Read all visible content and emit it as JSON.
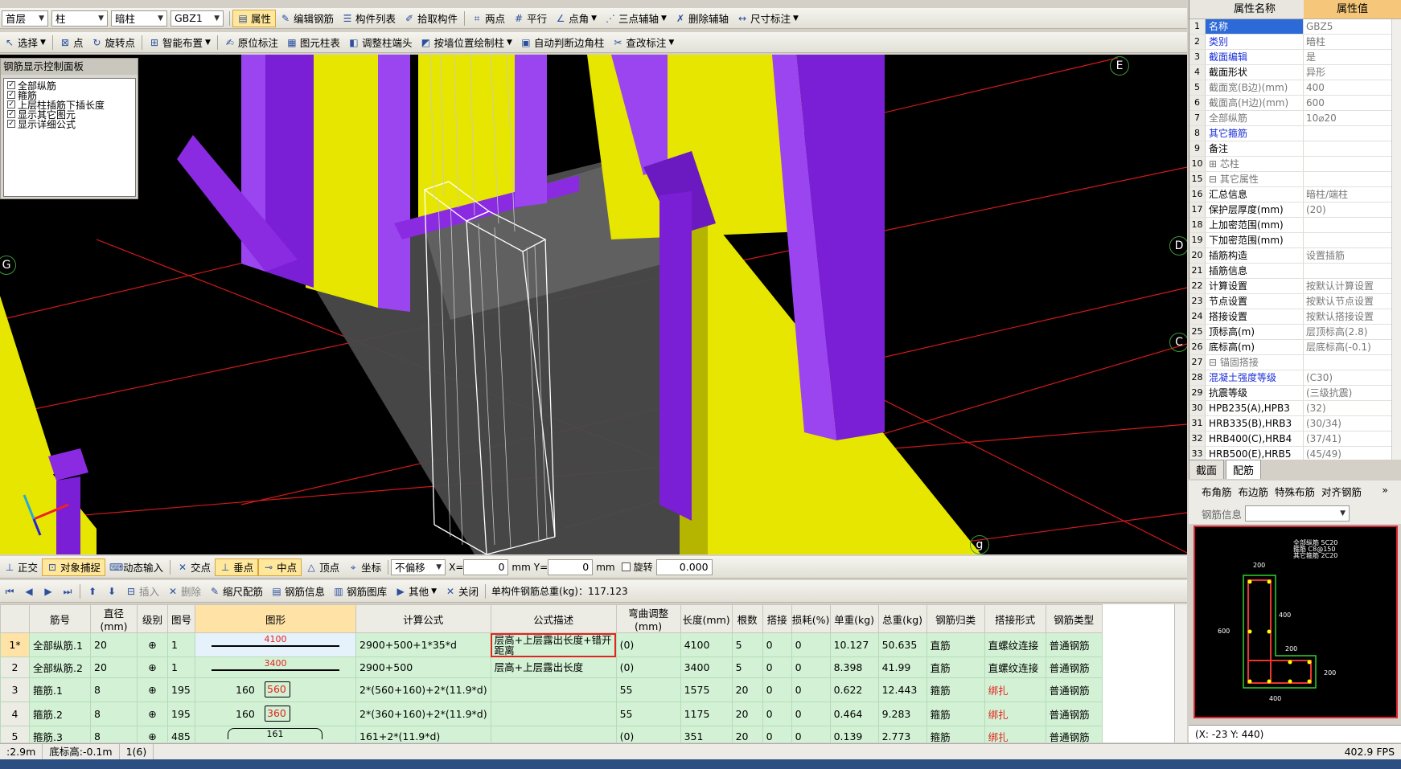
{
  "toolbar1": {
    "floor": "首层",
    "type": "柱",
    "subtype": "暗柱",
    "element": "GBZ1",
    "buttons": [
      "属性",
      "编辑钢筋",
      "构件列表",
      "拾取构件",
      "两点",
      "平行",
      "点角",
      "三点辅轴",
      "删除辅轴",
      "尺寸标注"
    ]
  },
  "toolbar2": {
    "buttons": [
      "选择",
      "点",
      "旋转点",
      "智能布置",
      "原位标注",
      "图元柱表",
      "调整柱端头",
      "按墙位置绘制柱",
      "自动判断边角柱",
      "查改标注"
    ]
  },
  "rebar_panel": {
    "title": "钢筋显示控制面板",
    "options": [
      "全部纵筋",
      "箍筋",
      "上层柱插筋下插长度",
      "显示其它图元",
      "显示详细公式"
    ]
  },
  "axis_labels": [
    "E",
    "D",
    "C",
    "G",
    "g"
  ],
  "properties": {
    "col_name": "属性名称",
    "col_value": "属性值",
    "rows": [
      {
        "n": "1",
        "name": "名称",
        "value": "GBZ5"
      },
      {
        "n": "2",
        "name": "类别",
        "value": "暗柱"
      },
      {
        "n": "3",
        "name": "截面编辑",
        "value": "是"
      },
      {
        "n": "4",
        "name": "截面形状",
        "value": "异形"
      },
      {
        "n": "5",
        "name": "截面宽(B边)(mm)",
        "value": "400"
      },
      {
        "n": "6",
        "name": "截面高(H边)(mm)",
        "value": "600"
      },
      {
        "n": "7",
        "name": "全部纵筋",
        "value": "10⌀20"
      },
      {
        "n": "8",
        "name": "其它箍筋",
        "value": ""
      },
      {
        "n": "9",
        "name": "备注",
        "value": ""
      },
      {
        "n": "10",
        "name": "⊞ 芯柱",
        "value": ""
      },
      {
        "n": "15",
        "name": "⊟ 其它属性",
        "value": ""
      },
      {
        "n": "16",
        "name": "  汇总信息",
        "value": "暗柱/端柱"
      },
      {
        "n": "17",
        "name": "  保护层厚度(mm)",
        "value": "(20)"
      },
      {
        "n": "18",
        "name": "  上加密范围(mm)",
        "value": ""
      },
      {
        "n": "19",
        "name": "  下加密范围(mm)",
        "value": ""
      },
      {
        "n": "20",
        "name": "  插筋构造",
        "value": "设置插筋"
      },
      {
        "n": "21",
        "name": "  插筋信息",
        "value": ""
      },
      {
        "n": "22",
        "name": "  计算设置",
        "value": "按默认计算设置"
      },
      {
        "n": "23",
        "name": "  节点设置",
        "value": "按默认节点设置"
      },
      {
        "n": "24",
        "name": "  搭接设置",
        "value": "按默认搭接设置"
      },
      {
        "n": "25",
        "name": "  顶标高(m)",
        "value": "层顶标高(2.8)"
      },
      {
        "n": "26",
        "name": "  底标高(m)",
        "value": "层底标高(-0.1)"
      },
      {
        "n": "27",
        "name": "⊟ 锚固搭接",
        "value": ""
      },
      {
        "n": "28",
        "name": "  混凝土强度等级",
        "value": "(C30)"
      },
      {
        "n": "29",
        "name": "  抗震等级",
        "value": "(三级抗震)"
      },
      {
        "n": "30",
        "name": "  HPB235(A),HPB3",
        "value": "(32)"
      },
      {
        "n": "31",
        "name": "  HRB335(B),HRB3",
        "value": "(30/34)"
      },
      {
        "n": "32",
        "name": "  HRB400(C),HRB4",
        "value": "(37/41)"
      },
      {
        "n": "33",
        "name": "  HRB500(E),HRB5",
        "value": "(45/49)"
      }
    ]
  },
  "right_tabs": [
    "截面",
    "配筋"
  ],
  "rebar_tools": {
    "buttons": [
      "布角筋",
      "布边筋",
      "特殊布筋",
      "对齐钢筋"
    ],
    "info_label": "钢筋信息"
  },
  "section": {
    "legend": [
      "全部纵筋 5C20",
      "箍筋 C8@150",
      "其它箍筋 2C20"
    ],
    "dims": [
      "200",
      "600",
      "400",
      "200",
      "200",
      "400"
    ]
  },
  "coords": "(X: -23 Y: 440)",
  "snapbar": {
    "buttons": [
      "正交",
      "对象捕捉",
      "动态输入",
      "交点",
      "垂点",
      "中点",
      "顶点",
      "坐标"
    ],
    "offset": "不偏移",
    "x_label": "X=",
    "x_val": "0",
    "mm1": "mm",
    "y_label": "Y=",
    "y_val": "0",
    "mm2": "mm",
    "rotate_label": "旋转",
    "rotate_val": "0.000"
  },
  "tablebar": {
    "buttons": [
      "插入",
      "删除",
      "缩尺配筋",
      "钢筋信息",
      "钢筋图库",
      "其他",
      "关闭"
    ],
    "total": "单构件钢筋总重(kg)：117.123"
  },
  "table": {
    "headers": [
      "",
      "筋号",
      "直径(mm)",
      "级别",
      "图号",
      "图形",
      "计算公式",
      "公式描述",
      "弯曲调整(mm)",
      "长度(mm)",
      "根数",
      "搭接",
      "损耗(%)",
      "单重(kg)",
      "总重(kg)",
      "钢筋归类",
      "搭接形式",
      "钢筋类型"
    ],
    "rows": [
      {
        "rn": "1*",
        "name": "全部纵筋.1",
        "dia": "20",
        "grade": "⊕",
        "fig": "1",
        "shape": "4100",
        "formula": "2900+500+1*35*d",
        "desc": "层高+上层露出长度+错开距离",
        "bend": "(0)",
        "len": "4100",
        "count": "5",
        "lap": "0",
        "loss": "0",
        "unit": "10.127",
        "total": "50.635",
        "cat": "直筋",
        "laptype": "直螺纹连接",
        "rtype": "普通钢筋"
      },
      {
        "rn": "2",
        "name": "全部纵筋.2",
        "dia": "20",
        "grade": "⊕",
        "fig": "1",
        "shape": "3400",
        "formula": "2900+500",
        "desc": "层高+上层露出长度",
        "bend": "(0)",
        "len": "3400",
        "count": "5",
        "lap": "0",
        "loss": "0",
        "unit": "8.398",
        "total": "41.99",
        "cat": "直筋",
        "laptype": "直螺纹连接",
        "rtype": "普通钢筋"
      },
      {
        "rn": "3",
        "name": "箍筋.1",
        "dia": "8",
        "grade": "⊕",
        "fig": "195",
        "shape_a": "160",
        "shape_b": "560",
        "formula": "2*(560+160)+2*(11.9*d)",
        "desc": "",
        "bend": "55",
        "len": "1575",
        "count": "20",
        "lap": "0",
        "loss": "0",
        "unit": "0.622",
        "total": "12.443",
        "cat": "箍筋",
        "laptype": "绑扎",
        "rtype": "普通钢筋"
      },
      {
        "rn": "4",
        "name": "箍筋.2",
        "dia": "8",
        "grade": "⊕",
        "fig": "195",
        "shape_a": "160",
        "shape_b": "360",
        "formula": "2*(360+160)+2*(11.9*d)",
        "desc": "",
        "bend": "55",
        "len": "1175",
        "count": "20",
        "lap": "0",
        "loss": "0",
        "unit": "0.464",
        "total": "9.283",
        "cat": "箍筋",
        "laptype": "绑扎",
        "rtype": "普通钢筋"
      },
      {
        "rn": "5",
        "name": "箍筋.3",
        "dia": "8",
        "grade": "⊕",
        "fig": "485",
        "shape": "161",
        "formula": "161+2*(11.9*d)",
        "desc": "",
        "bend": "(0)",
        "len": "351",
        "count": "20",
        "lap": "0",
        "loss": "0",
        "unit": "0.139",
        "total": "2.773",
        "cat": "箍筋",
        "laptype": "绑扎",
        "rtype": "普通钢筋"
      }
    ]
  },
  "status": {
    "height": ":2.9m",
    "bottom": "底标高:-0.1m",
    "count": "1(6)",
    "fps": "402.9 FPS"
  },
  "colors": {
    "yellow": "#e6e600",
    "purple": "#8a2be2",
    "grid_red": "#d21a1a",
    "row_green": "#d3f2d5",
    "highlight_red": "#e3231e"
  }
}
